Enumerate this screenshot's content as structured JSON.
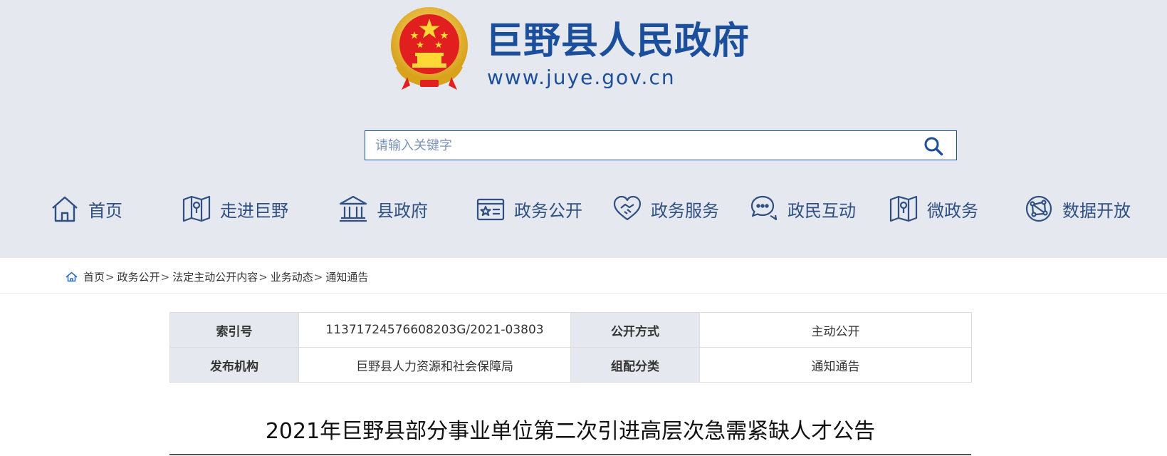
{
  "header": {
    "site_title": "巨野县人民政府",
    "site_url": "www.juye.gov.cn",
    "brand_color": "#1b4f9c",
    "emblem_icon": "national-emblem-icon"
  },
  "search": {
    "placeholder": "请输入关键字",
    "value": "",
    "icon": "search-icon"
  },
  "nav": {
    "items": [
      {
        "label": "首页",
        "icon": "home-icon"
      },
      {
        "label": "走进巨野",
        "icon": "map-icon"
      },
      {
        "label": "县政府",
        "icon": "government-building-icon"
      },
      {
        "label": "政务公开",
        "icon": "announcement-card-icon"
      },
      {
        "label": "政务服务",
        "icon": "handshake-icon"
      },
      {
        "label": "政民互动",
        "icon": "chat-bubbles-icon"
      },
      {
        "label": "微政务",
        "icon": "map-icon"
      },
      {
        "label": "数据开放",
        "icon": "network-globe-icon"
      }
    ]
  },
  "breadcrumb": {
    "separator": ">",
    "items": [
      "首页",
      "政务公开",
      "法定主动公开内容",
      "业务动态",
      "通知通告"
    ]
  },
  "meta": {
    "index_label": "索引号",
    "index_value": "11371724576608203G/2021-03803",
    "method_label": "公开方式",
    "method_value": "主动公开",
    "org_label": "发布机构",
    "org_value": "巨野县人力资源和社会保障局",
    "category_label": "组配分类",
    "category_value": "通知通告"
  },
  "article": {
    "title": "2021年巨野县部分事业单位第二次引进高层次急需紧缺人才公告"
  }
}
